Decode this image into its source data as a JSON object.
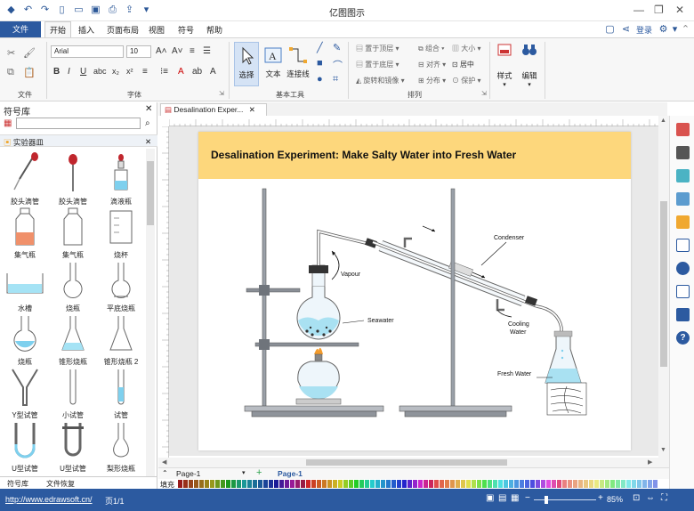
{
  "app": {
    "title": "亿图图示"
  },
  "menu": {
    "file": "文件",
    "start": "开始",
    "insert": "插入",
    "page_layout": "页面布局",
    "view": "视图",
    "symbols": "符号",
    "help": "帮助",
    "login": "登录"
  },
  "ribbon": {
    "font_name": "Arial",
    "font_size": "10",
    "group_file": "文件",
    "group_font": "字体",
    "group_basic_tools": "基本工具",
    "group_arrange": "排列",
    "select_label": "选择",
    "text_label": "文本",
    "connector_label": "连接线",
    "bring_front": "置于顶层",
    "send_back": "置于底层",
    "rotate_mirror": "旋转和镜像",
    "group": "组合",
    "align": "对齐",
    "distribute": "分布",
    "size": "大小",
    "center": "居中",
    "protect": "保护",
    "style": "样式",
    "edit": "编辑"
  },
  "library": {
    "title": "符号库",
    "category": "实验器皿",
    "items": [
      "胶头滴管",
      "胶头滴管",
      "滴液瓶",
      "集气瓶",
      "集气瓶",
      "烧杯",
      "水槽",
      "烧瓶",
      "平底烧瓶",
      "烧瓶",
      "锥形烧瓶",
      "锥形烧瓶 2",
      "Y型试管",
      "小试管",
      "试管",
      "U型试管",
      "U型试管",
      "梨形烧瓶"
    ],
    "tab_symbols": "符号库",
    "tab_recovery": "文件恢复"
  },
  "document": {
    "tab_title": "Desalination Exper...",
    "heading": "Desalination Experiment: Make Salty Water into Fresh Water",
    "labels": {
      "vapour": "Vapour",
      "seawater": "Seawater",
      "condenser": "Condenser",
      "cooling_water_1": "Cooling",
      "cooling_water_2": "Water",
      "fresh_water": "Fresh Water"
    }
  },
  "pages": {
    "current": "Page-1",
    "tab": "Page-1",
    "fill_label": "填充"
  },
  "status": {
    "url": "http://www.edrawsoft.cn/",
    "page_info": "页1/1",
    "zoom": "85%"
  },
  "colors": {
    "accent": "#2c5aa0",
    "heading_band": "#fdd77c"
  }
}
